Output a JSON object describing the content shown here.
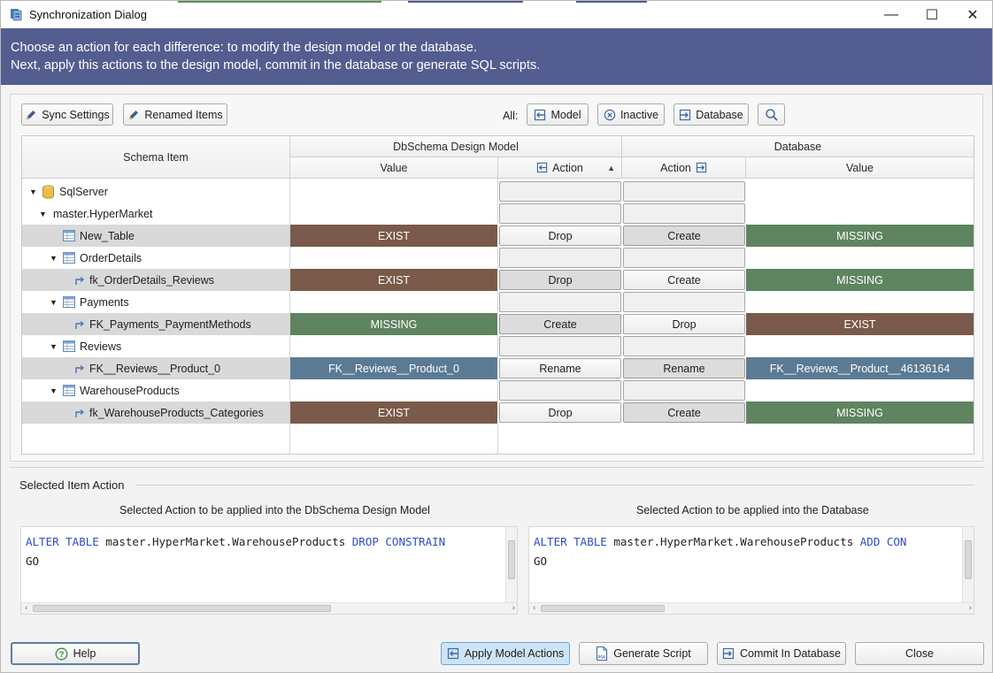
{
  "window": {
    "title": "Synchronization Dialog",
    "minimize_label": "—",
    "maximize_label": "☐",
    "close_label": "✕"
  },
  "banner": {
    "line1": "Choose an action for each difference: to modify the design model or the database.",
    "line2": "Next, apply this actions to the design model, commit in the database or generate SQL scripts."
  },
  "toolbar": {
    "sync_settings": "Sync Settings",
    "renamed_items": "Renamed Items",
    "all_label": "All:",
    "model": "Model",
    "inactive": "Inactive",
    "database": "Database"
  },
  "grid": {
    "headers": {
      "schema_item": "Schema Item",
      "design_model": "DbSchema Design Model",
      "database": "Database",
      "value": "Value",
      "action": "Action",
      "db_action": "Action",
      "db_value": "Value"
    },
    "rows": [
      {
        "label": "SqlServer",
        "icon": "database-icon",
        "model_value": "",
        "model_action": "",
        "db_action": "",
        "db_value": ""
      },
      {
        "label": "master.HyperMarket",
        "icon": "",
        "model_value": "",
        "model_action": "",
        "db_action": "",
        "db_value": ""
      },
      {
        "label": "New_Table",
        "icon": "table-icon",
        "model_value": "EXIST",
        "model_action": "Drop",
        "db_action": "Create",
        "db_value": "MISSING"
      },
      {
        "label": "OrderDetails",
        "icon": "table-icon",
        "model_value": "",
        "model_action": "",
        "db_action": "",
        "db_value": ""
      },
      {
        "label": "fk_OrderDetails_Reviews",
        "icon": "foreign-key-icon",
        "model_value": "EXIST",
        "model_action": "Drop",
        "db_action": "Create",
        "db_value": "MISSING"
      },
      {
        "label": "Payments",
        "icon": "table-icon",
        "model_value": "",
        "model_action": "",
        "db_action": "",
        "db_value": ""
      },
      {
        "label": "FK_Payments_PaymentMethods",
        "icon": "foreign-key-icon",
        "model_value": "MISSING",
        "model_action": "Create",
        "db_action": "Drop",
        "db_value": "EXIST"
      },
      {
        "label": "Reviews",
        "icon": "table-icon",
        "model_value": "",
        "model_action": "",
        "db_action": "",
        "db_value": ""
      },
      {
        "label": "FK__Reviews__Product_0",
        "icon": "foreign-key-icon",
        "model_value": "FK__Reviews__Product_0",
        "model_action": "Rename",
        "db_action": "Rename",
        "db_value": "FK__Reviews__Product__46136164"
      },
      {
        "label": "WarehouseProducts",
        "icon": "table-icon",
        "model_value": "",
        "model_action": "",
        "db_action": "",
        "db_value": ""
      },
      {
        "label": "fk_WarehouseProducts_Categories",
        "icon": "foreign-key-icon",
        "model_value": "EXIST",
        "model_action": "Drop",
        "db_action": "Create",
        "db_value": "MISSING"
      }
    ],
    "colors": {
      "exist": "#7a5a4a",
      "missing": "#5e8460",
      "rename": "#5b7a93"
    }
  },
  "selected_action": {
    "title": "Selected Item Action",
    "model_caption": "Selected Action to be applied into the DbSchema Design Model",
    "db_caption": "Selected Action to be applied into the Database",
    "model_sql_kw1": "ALTER TABLE",
    "model_sql_obj": " master.HyperMarket.WarehouseProducts ",
    "model_sql_kw2": "DROP CONSTRAIN",
    "db_sql_kw1": "ALTER TABLE",
    "db_sql_obj": " master.HyperMarket.WarehouseProducts ",
    "db_sql_kw2": "ADD CON",
    "go": "GO"
  },
  "footer": {
    "help": "Help",
    "apply_model_actions": "Apply Model Actions",
    "generate_script": "Generate Script",
    "commit_in_database": "Commit In Database",
    "close": "Close"
  }
}
